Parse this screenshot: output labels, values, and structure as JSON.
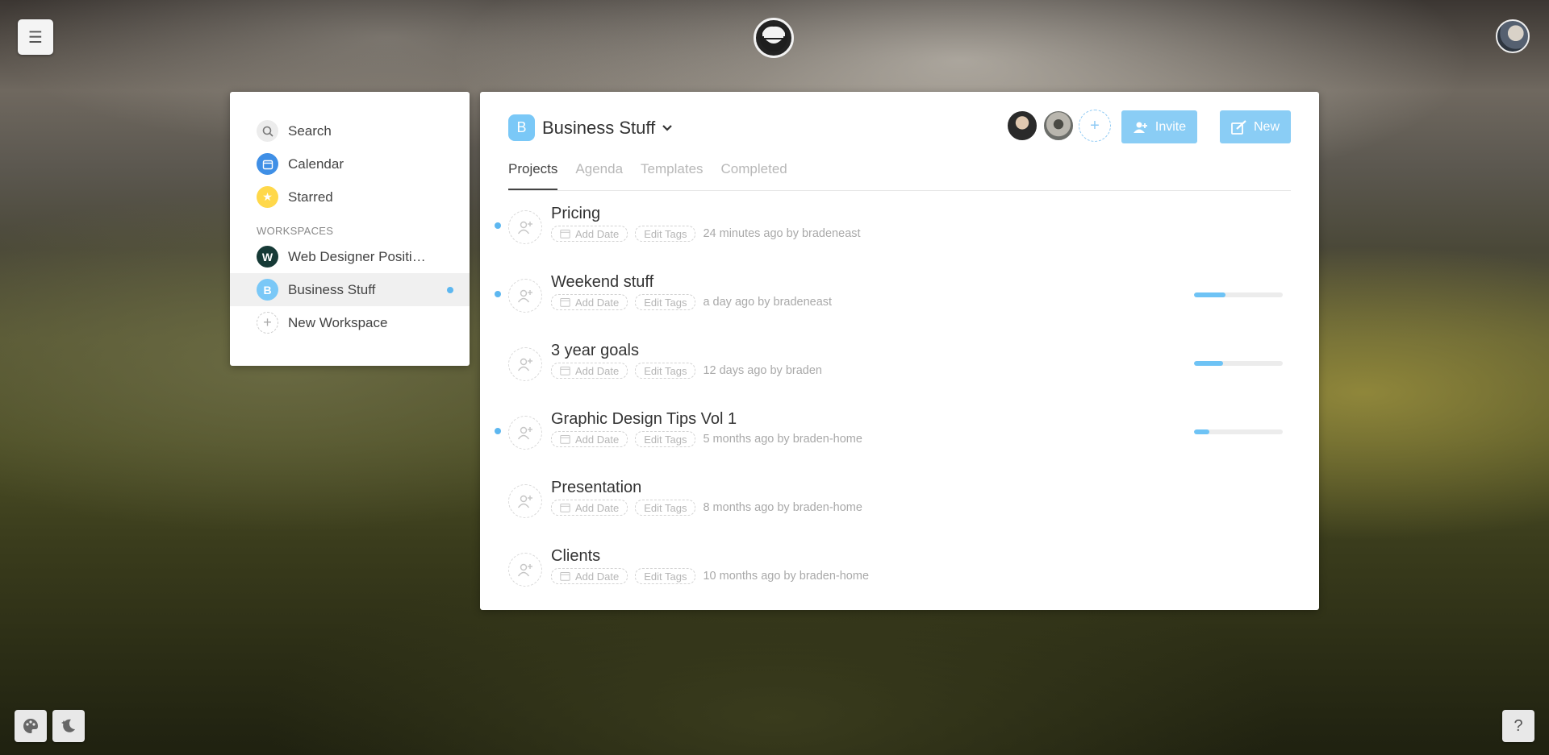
{
  "topbar": {
    "menu_icon": "hamburger-icon",
    "logo_icon": "sheep-logo-icon",
    "user_avatar": "user-avatar"
  },
  "sidebar": {
    "items": [
      {
        "label": "Search",
        "icon": "search-icon",
        "color": "#e9e9e9"
      },
      {
        "label": "Calendar",
        "icon": "calendar-icon",
        "color": "#3f8fe6"
      },
      {
        "label": "Starred",
        "icon": "star-icon",
        "color": "#ffd84a"
      }
    ],
    "workspaces_heading": "WORKSPACES",
    "workspaces": [
      {
        "label": "Web Designer Positi…",
        "badge": "W",
        "color": "#163a36",
        "active": false
      },
      {
        "label": "Business Stuff",
        "badge": "B",
        "color": "#7ac8f7",
        "active": true
      }
    ],
    "new_workspace_label": "New Workspace"
  },
  "workspace": {
    "badge": "B",
    "title": "Business Stuff",
    "invite_label": "Invite",
    "new_label": "New",
    "accent_color": "#8acdf5"
  },
  "tabs": [
    {
      "label": "Projects",
      "active": true
    },
    {
      "label": "Agenda",
      "active": false
    },
    {
      "label": "Templates",
      "active": false
    },
    {
      "label": "Completed",
      "active": false
    }
  ],
  "projects": [
    {
      "title": "Pricing",
      "date_chip": "Add Date",
      "tags_chip": "Edit Tags",
      "updated": "24 minutes ago by bradeneast",
      "unread": true,
      "progress": null
    },
    {
      "title": "Weekend stuff",
      "date_chip": "Add Date",
      "tags_chip": "Edit Tags",
      "updated": "a day ago by bradeneast",
      "unread": true,
      "progress": 0.35
    },
    {
      "title": "3 year goals",
      "date_chip": "Add Date",
      "tags_chip": "Edit Tags",
      "updated": "12 days ago by braden",
      "unread": false,
      "progress": 0.33
    },
    {
      "title": "Graphic Design Tips Vol 1",
      "date_chip": "Add Date",
      "tags_chip": "Edit Tags",
      "updated": "5 months ago by braden-home",
      "unread": true,
      "progress": 0.17
    },
    {
      "title": "Presentation",
      "date_chip": "Add Date",
      "tags_chip": "Edit Tags",
      "updated": "8 months ago by braden-home",
      "unread": false,
      "progress": null
    },
    {
      "title": "Clients",
      "date_chip": "Add Date",
      "tags_chip": "Edit Tags",
      "updated": "10 months ago by braden-home",
      "unread": false,
      "progress": null
    }
  ],
  "footer": {
    "help_label": "?"
  }
}
